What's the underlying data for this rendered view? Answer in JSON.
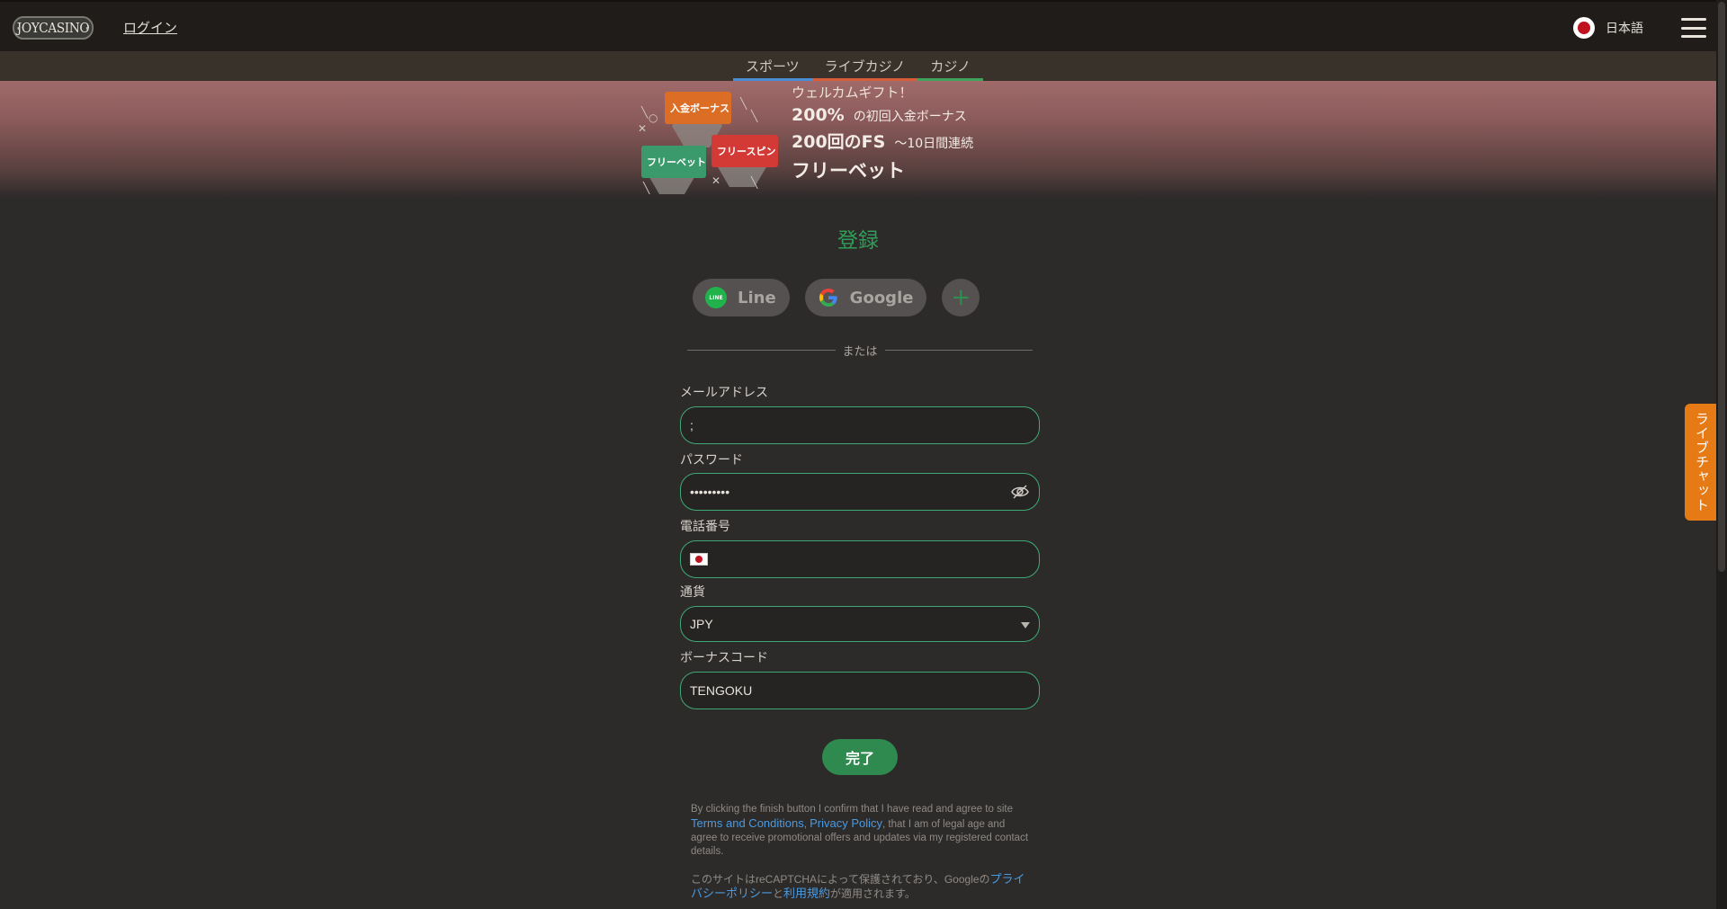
{
  "header": {
    "logo_text": "JOYCASINO",
    "login_label": "ログイン",
    "language_label": "日本語"
  },
  "nav": {
    "tabs": [
      {
        "label": "スポーツ"
      },
      {
        "label": "ライブカジノ"
      },
      {
        "label": "カジノ"
      }
    ]
  },
  "banner": {
    "tags": {
      "deposit_bonus": "入金ボーナス",
      "free_bet": "フリーベット",
      "free_spin": "フリースピン"
    },
    "welcome": "ウェルカムギフト！",
    "percent": "200%",
    "percent_desc": "の初回入金ボーナス",
    "fs": "200回のFS",
    "fs_desc": "～10日間連続",
    "freebet": "フリーベット"
  },
  "form": {
    "title": "登録",
    "social": {
      "line_label": "Line",
      "line_badge": "LINE",
      "google_label": "Google",
      "more_label": "+"
    },
    "divider_label": "または",
    "email": {
      "label": "メールアドレス",
      "value": ";"
    },
    "password": {
      "label": "パスワード",
      "value": "•••••••••"
    },
    "phone": {
      "label": "電話番号",
      "value": ""
    },
    "currency": {
      "label": "通貨",
      "value": "JPY"
    },
    "bonus_code": {
      "label": "ボーナスコード",
      "value": "TENGOKU"
    },
    "finish_label": "完了"
  },
  "legal": {
    "part1": "By clicking the finish button I confirm that I have read and agree to site ",
    "terms": "Terms and Conditions",
    "comma": ", ",
    "privacy": "Privacy Policy",
    "part2": ", that I am of legal age and agree to receive promotional offers and updates via my registered contact details."
  },
  "recaptcha": {
    "part1": "このサイトはreCAPTCHAによって保護されており、Googleの",
    "privacy": "プライバシーポリシー",
    "and": "と",
    "terms": "利用規約",
    "part2": "が適用されます。"
  },
  "chat": {
    "label": "ライブチャット"
  },
  "colors": {
    "accent_green": "#2e8a4e",
    "field_border": "#3ea974",
    "chat_orange": "#e67a14",
    "link_blue": "#4a9ae0"
  }
}
